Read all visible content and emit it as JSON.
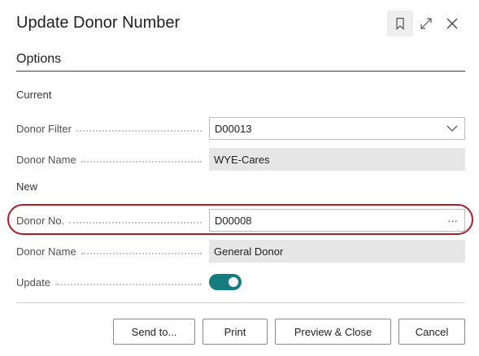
{
  "dialog": {
    "title": "Update Donor Number",
    "section_title": "Options",
    "group_current": "Current",
    "group_new": "New"
  },
  "current": {
    "donor_filter_label": "Donor Filter",
    "donor_filter_value": "D00013",
    "donor_name_label": "Donor Name",
    "donor_name_value": "WYE-Cares"
  },
  "new": {
    "donor_no_label": "Donor No.",
    "donor_no_value": "D00008",
    "donor_no_lookup": "···",
    "donor_name_label": "Donor Name",
    "donor_name_value": "General Donor",
    "update_label": "Update",
    "update_on": true
  },
  "buttons": {
    "send_to": "Send to...",
    "print": "Print",
    "preview_close": "Preview & Close",
    "cancel": "Cancel"
  },
  "icons": {
    "bookmark": "bookmark-icon",
    "expand": "expand-icon",
    "close": "close-icon",
    "dropdown": "chevron-down-icon"
  },
  "colors": {
    "toggle_on": "#147d80",
    "highlight_oval": "#b01e24",
    "readonly_bg": "#e6e6e6"
  }
}
